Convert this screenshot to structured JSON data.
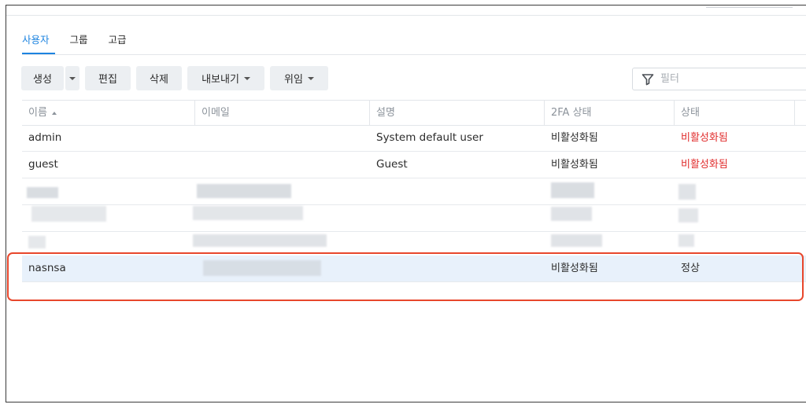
{
  "tabs": [
    {
      "label": "사용자",
      "active": true
    },
    {
      "label": "그룹",
      "active": false
    },
    {
      "label": "고급",
      "active": false
    }
  ],
  "toolbar": {
    "create_label": "생성",
    "edit_label": "편집",
    "delete_label": "삭제",
    "export_label": "내보내기",
    "delegate_label": "위임"
  },
  "filter": {
    "placeholder": "필터"
  },
  "table": {
    "headers": [
      "이름",
      "이메일",
      "설명",
      "2FA 상태",
      "상태"
    ],
    "rows": [
      {
        "name": "admin",
        "email": "",
        "description": "System default user",
        "twofa": "비활성화됨",
        "status": "비활성화됨"
      },
      {
        "name": "guest",
        "email": "",
        "description": "Guest",
        "twofa": "비활성화됨",
        "status": "비활성화됨"
      },
      {
        "name": "nasnsa",
        "email": "",
        "description": "",
        "twofa": "비활성화됨",
        "status": "정상"
      }
    ]
  },
  "colors": {
    "accent": "#1d84e0",
    "disabled_status": "#e02c2c",
    "highlight": "#e8472c",
    "selected_row": "#e8f1fb"
  }
}
